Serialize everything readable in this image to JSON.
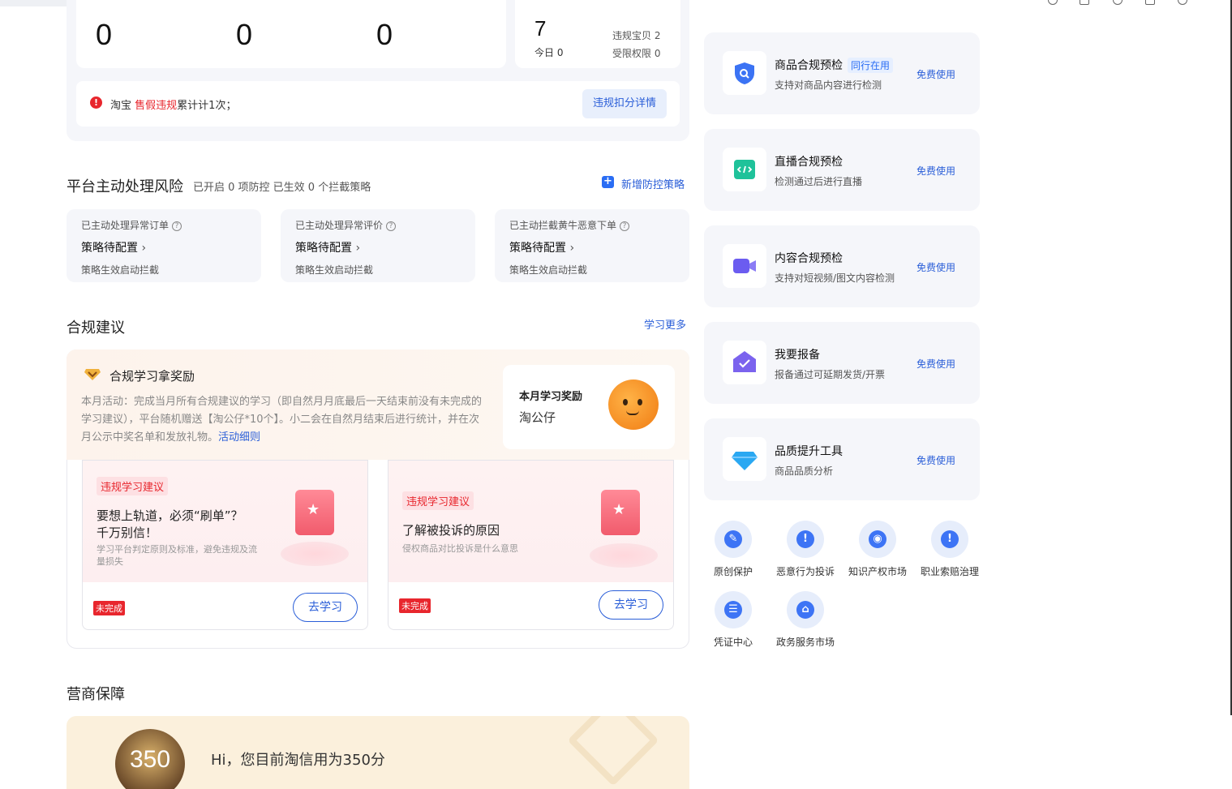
{
  "stats": {
    "values": [
      "0",
      "0",
      "0"
    ],
    "violation_count": "7",
    "today_label": "今日 0",
    "violation_items": "违规宝贝 2",
    "restricted": "受限权限 0"
  },
  "alert": {
    "platform": "淘宝",
    "type": "售假违规",
    "suffix": "累计计1次；",
    "detail_button": "违规扣分详情"
  },
  "risk": {
    "title": "平台主动处理风险",
    "summary": "已开启 0 项防控 已生效 0 个拦截策略",
    "add_link": "新增防控策略",
    "cards": [
      {
        "label": "已主动处理异常订单",
        "status": "策略待配置",
        "note": "策略生效启动拦截"
      },
      {
        "label": "已主动处理异常评价",
        "status": "策略待配置",
        "note": "策略生效启动拦截"
      },
      {
        "label": "已主动拦截黄牛恶意下单",
        "status": "策略待配置",
        "note": "策略生效启动拦截"
      }
    ]
  },
  "compliance": {
    "title": "合规建议",
    "more_link": "学习更多",
    "reward_title": "合规学习拿奖励",
    "activity_text": "本月活动：完成当月所有合规建议的学习（即自然月月底最后一天结束前没有未完成的学习建议），平台随机赠送【淘公仔*10个】。小二会在自然月结束后进行统计，并在次月公示中奖名单和发放礼物。",
    "rules_link": "活动细则",
    "monthly_reward_label": "本月学习奖励",
    "monthly_reward_item": "淘公仔",
    "cards": [
      {
        "tag": "违规学习建议",
        "title_line1": "要想上轨道，必须“刷单”？",
        "title_line2": "千万别信！",
        "desc_line1": "学习平台判定原则及标准，避免违规及流",
        "desc_line2": "量损失",
        "status": "未完成",
        "button": "去学习"
      },
      {
        "tag": "违规学习建议",
        "title_line1": "了解被投诉的原因",
        "desc_line1": "侵权商品对比投诉是什么意思",
        "status": "未完成",
        "button": "去学习"
      }
    ]
  },
  "guarantee": {
    "title": "营商保障",
    "score": "350",
    "message": "Hi，您目前淘信用为350分"
  },
  "tools": [
    {
      "name": "商品合规预检",
      "tag": "同行在用",
      "desc": "支持对商品内容进行检测",
      "action": "免费使用",
      "icon": "shield-search-icon",
      "color": "#3b73f4"
    },
    {
      "name": "直播合规预检",
      "desc": "检测通过后进行直播",
      "action": "免费使用",
      "icon": "code-icon",
      "color": "#1fc29a"
    },
    {
      "name": "内容合规预检",
      "desc": "支持对短视频/图文内容检测",
      "action": "免费使用",
      "icon": "video-icon",
      "color": "#6b5cf0"
    },
    {
      "name": "我要报备",
      "desc": "报备通过可延期发货/开票",
      "action": "免费使用",
      "icon": "house-check-icon",
      "color": "#7b63ee"
    },
    {
      "name": "品质提升工具",
      "desc": "商品品质分析",
      "action": "免费使用",
      "icon": "diamond-icon",
      "color": "#2aa8f2"
    }
  ],
  "quick_links": [
    {
      "label": "原创保护",
      "icon": "pen-icon",
      "glyph": "✎"
    },
    {
      "label": "恶意行为投诉",
      "icon": "alert-icon",
      "glyph": "!"
    },
    {
      "label": "知识产权市场",
      "icon": "bulb-icon",
      "glyph": "◉"
    },
    {
      "label": "职业索赔治理",
      "icon": "alert-icon",
      "glyph": "!"
    },
    {
      "label": "凭证中心",
      "icon": "ticket-icon",
      "glyph": "☰"
    },
    {
      "label": "政务服务市场",
      "icon": "bank-icon",
      "glyph": "⌂"
    }
  ]
}
